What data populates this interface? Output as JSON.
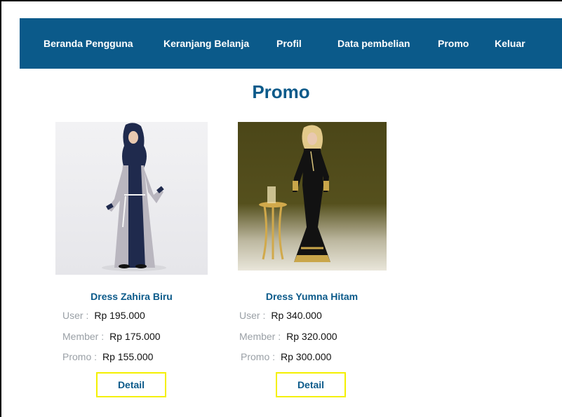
{
  "nav": {
    "items": [
      {
        "label": "Beranda Pengguna"
      },
      {
        "label": "Keranjang Belanja"
      },
      {
        "label": "Profil"
      },
      {
        "label": "Data pembelian"
      },
      {
        "label": "Promo"
      },
      {
        "label": "Keluar"
      }
    ]
  },
  "page": {
    "title": "Promo"
  },
  "products": [
    {
      "name": "Dress Zahira Biru",
      "user_label": "User :",
      "user_price": "Rp 195.000",
      "member_label": "Member :",
      "member_price": "Rp 175.000",
      "promo_label": "Promo :",
      "promo_price": "Rp 155.000",
      "detail_label": "Detail"
    },
    {
      "name": "Dress Yumna Hitam",
      "user_label": "User :",
      "user_price": "Rp 340.000",
      "member_label": "Member :",
      "member_price": "Rp 320.000",
      "promo_label": "Promo :",
      "promo_price": "Rp 300.000",
      "detail_label": "Detail"
    }
  ],
  "colors": {
    "navbar": "#0b5a8a",
    "title": "#0b5a8a",
    "detail_border": "#f4f000"
  }
}
